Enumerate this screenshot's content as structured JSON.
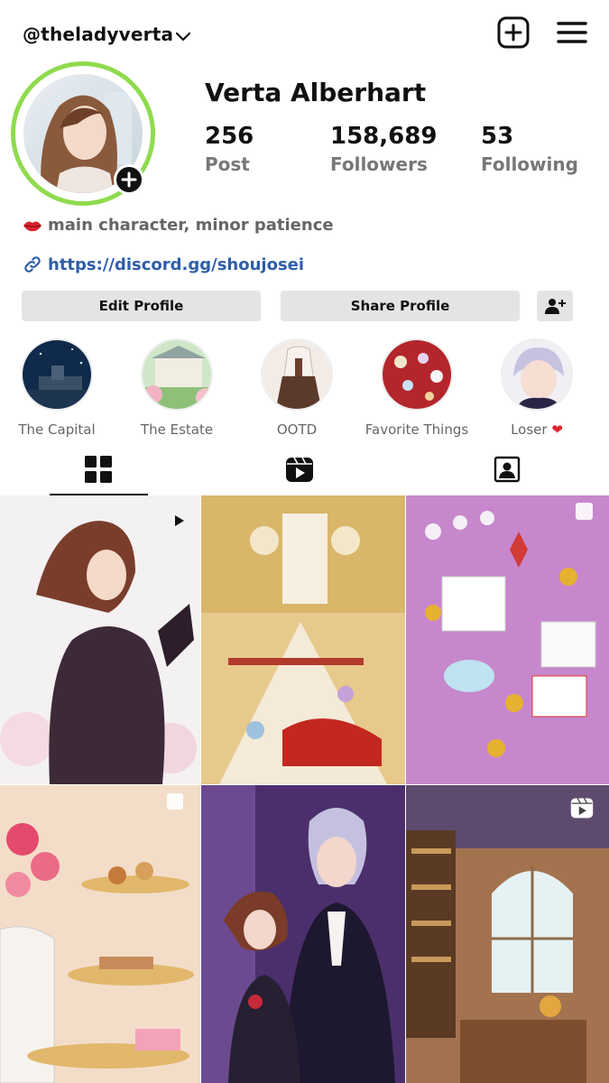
{
  "header": {
    "username": "@theladyverta",
    "icons": {
      "dropdown": "chevron-down-icon",
      "new_post": "plus-square-icon",
      "menu": "hamburger-menu-icon"
    }
  },
  "profile": {
    "display_name": "Verta Alberhart",
    "stats": [
      {
        "value": "256",
        "label": "Post"
      },
      {
        "value": "158,689",
        "label": "Followers"
      },
      {
        "value": "53",
        "label": "Following"
      }
    ],
    "bio": "main character, minor patience",
    "bio_icon": "lips-icon",
    "link": "https://discord.gg/shoujosei",
    "link_icon": "link-icon",
    "ring_color": "#8fdb4e"
  },
  "actions": {
    "edit_profile": "Edit Profile",
    "share_profile": "Share Profile",
    "add_person_icon": "add-person-icon"
  },
  "highlights": [
    {
      "label": "The Capital"
    },
    {
      "label": "The Estate"
    },
    {
      "label": "OOTD"
    },
    {
      "label": "Favorite Things"
    },
    {
      "label": "Loser",
      "suffix": "❤"
    }
  ],
  "tabs": [
    {
      "name": "grid",
      "icon": "grid-icon",
      "active": true
    },
    {
      "name": "reels",
      "icon": "reels-icon",
      "active": false
    },
    {
      "name": "tagged",
      "icon": "tagged-person-icon",
      "active": false
    }
  ],
  "posts": [
    {
      "subject": "woman in dark dress",
      "badge": "play-icon"
    },
    {
      "subject": "ballroom banquet",
      "badge": ""
    },
    {
      "subject": "gifts and jewels",
      "badge": "multiple-posts-icon"
    },
    {
      "subject": "afternoon tea",
      "badge": "multiple-posts-icon"
    },
    {
      "subject": "couple portrait",
      "badge": ""
    },
    {
      "subject": "library room",
      "badge": "reels-icon"
    }
  ]
}
